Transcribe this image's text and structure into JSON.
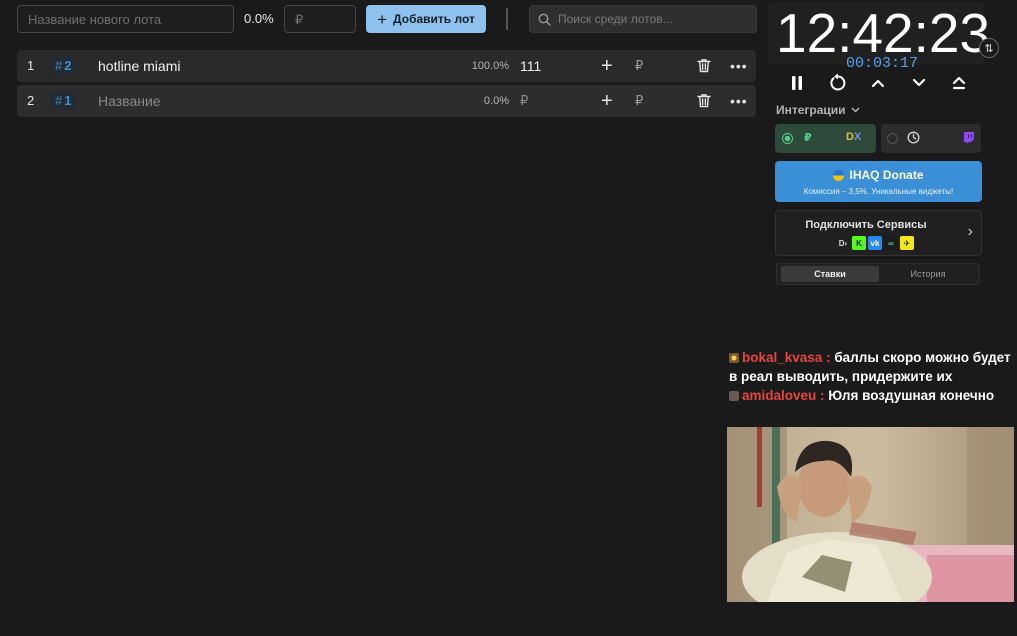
{
  "topbar": {
    "new_lot_placeholder": "Название нового лота",
    "total_percent": "0.0%",
    "amount_placeholder": "₽",
    "add_button_label": "Добавить лот",
    "search_placeholder": "Поиск среди лотов..."
  },
  "lots": [
    {
      "index": "1",
      "id_hash": "#",
      "id_num": "2",
      "name": "hotline miami",
      "percent": "100.0%",
      "amount": "111",
      "add": "+",
      "currency": "₽",
      "more": "•••"
    },
    {
      "index": "2",
      "id_hash": "#",
      "id_num": "1",
      "name": "Название",
      "percent": "0.0%",
      "amount": "₽",
      "add": "+",
      "currency": "₽",
      "more": "•••"
    }
  ],
  "timer": {
    "main": "12:42:23",
    "elapsed": "00:03:17",
    "swap_icon": "⇅"
  },
  "integrations": {
    "label": "Интеграции",
    "left_rub": "₽",
    "left_logo": "D",
    "left_logo_x": "X"
  },
  "donate": {
    "title": "IHAQ Donate",
    "subtitle": "Комиссия – 3,5%. Уникальные виджеты!"
  },
  "services": {
    "title": "Подключить Сервисы",
    "icons": [
      "D›",
      "K",
      "vk",
      "∞",
      "✈"
    ],
    "arrow": "›"
  },
  "tabs": {
    "bets": "Ставки",
    "history": "История"
  },
  "chat": [
    {
      "user": "bokal_kvasa",
      "separator": " :",
      "text": "баллы скоро можно будет в реал выводить, придержите их"
    },
    {
      "user": "amidaloveu",
      "separator": " :",
      "text": "Юля воздушная конечно"
    }
  ],
  "colors": {
    "accent_blue": "#3f8fd9",
    "add_button": "#8fc1ee",
    "donate_blue": "#3a8fd7",
    "chat_username": "#e5463f",
    "integration_green": "#4ed18a"
  }
}
